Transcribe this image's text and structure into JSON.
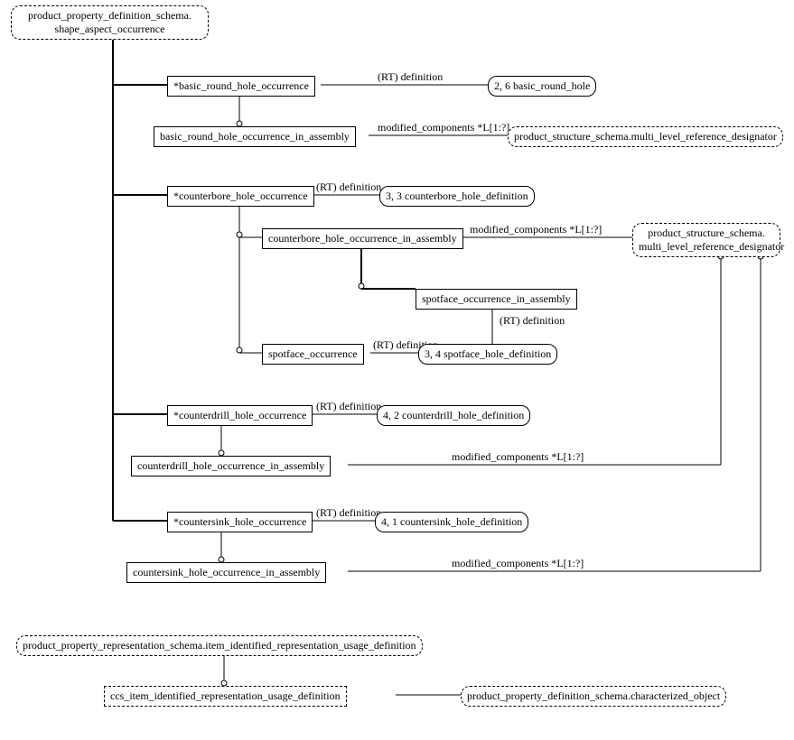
{
  "root": {
    "line1": "product_property_definition_schema.",
    "line2": "shape_aspect_occurrence"
  },
  "basic_round_hole_occurrence": "*basic_round_hole_occurrence",
  "basic_round_hole": "2, 6 basic_round_hole",
  "basic_in_assembly": "basic_round_hole_occurrence_in_assembly",
  "counterbore_occurrence": "*counterbore_hole_occurrence",
  "counterbore_def": "3, 3 counterbore_hole_definition",
  "counterbore_in_assembly": "counterbore_hole_occurrence_in_assembly",
  "spotface_in_assembly": "spotface_occurrence_in_assembly",
  "spotface_occurrence": "spotface_occurrence",
  "spotface_def": "3, 4 spotface_hole_definition",
  "counterdrill_occurrence": "*counterdrill_hole_occurrence",
  "counterdrill_def": "4, 2 counterdrill_hole_definition",
  "counterdrill_in_assembly": "counterdrill_hole_occurrence_in_assembly",
  "countersink_occurrence": "*countersink_hole_occurrence",
  "countersink_def": "4, 1 countersink_hole_definition",
  "countersink_in_assembly": "countersink_hole_occurrence_in_assembly",
  "pss_mlrd_single": "product_structure_schema.multi_level_reference_designator",
  "pss_mlrd_line1": "product_structure_schema.",
  "pss_mlrd_line2": "multi_level_reference_designator",
  "rep_usage_def": "product_property_representation_schema.item_identified_representation_usage_definition",
  "ccs_item": "ccs_item_identified_representation_usage_definition",
  "char_object": "product_property_definition_schema.characterized_object",
  "lbl_rt_def": "(RT) definition",
  "lbl_mod_comp": "modified_components *L[1:?]"
}
